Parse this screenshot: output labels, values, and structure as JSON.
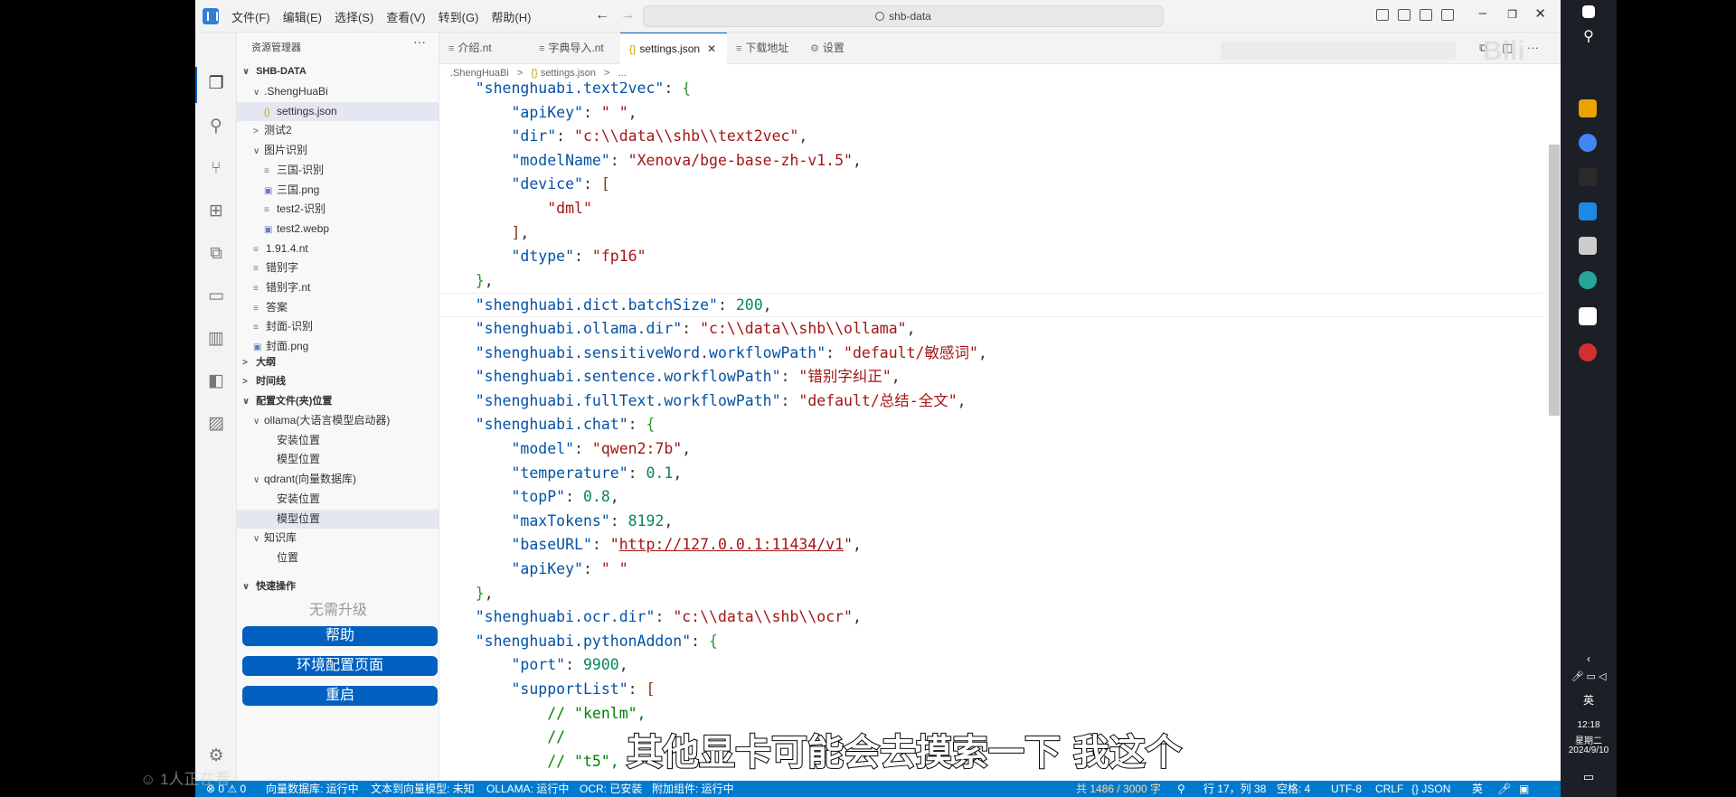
{
  "window": {
    "search": "shb-data",
    "menu": [
      "文件(F)",
      "编辑(E)",
      "选择(S)",
      "查看(V)",
      "转到(G)",
      "帮助(H)"
    ]
  },
  "sidebar": {
    "title": "资源管理器",
    "root": "SHB-DATA",
    "tree": [
      {
        "label": ".ShengHuaBi",
        "indent": 1,
        "chev": "∨"
      },
      {
        "label": "settings.json",
        "indent": 2,
        "icon": "{}",
        "selected": true
      },
      {
        "label": "测试2",
        "indent": 1,
        "chev": ">"
      },
      {
        "label": "图片识别",
        "indent": 1,
        "chev": "∨"
      },
      {
        "label": "三国-识别",
        "indent": 2,
        "icon": "≡"
      },
      {
        "label": "三国.png",
        "indent": 2,
        "icon": "▣"
      },
      {
        "label": "test2-识别",
        "indent": 2,
        "icon": "≡"
      },
      {
        "label": "test2.webp",
        "indent": 2,
        "icon": "▣"
      },
      {
        "label": "1.91.4.nt",
        "indent": 1,
        "icon": "≡"
      },
      {
        "label": "错别字",
        "indent": 1,
        "icon": "≡"
      },
      {
        "label": "错别字.nt",
        "indent": 1,
        "icon": "≡"
      },
      {
        "label": "答案",
        "indent": 1,
        "icon": "≡"
      },
      {
        "label": "封面-识别",
        "indent": 1,
        "icon": "≡"
      },
      {
        "label": "封面.png",
        "indent": 1,
        "icon": "▣"
      }
    ],
    "sections": [
      "大纲",
      "时间线",
      "配置文件(夹)位置"
    ],
    "config_tree": [
      {
        "label": "ollama(大语言模型启动器)",
        "indent": 1,
        "chev": "∨"
      },
      {
        "label": "安装位置",
        "indent": 2
      },
      {
        "label": "模型位置",
        "indent": 2
      },
      {
        "label": "qdrant(向量数据库)",
        "indent": 1,
        "chev": "∨"
      },
      {
        "label": "安装位置",
        "indent": 2
      },
      {
        "label": "模型位置",
        "indent": 2,
        "selected": true
      },
      {
        "label": "知识库",
        "indent": 1,
        "chev": "∨"
      },
      {
        "label": "位置",
        "indent": 2
      }
    ],
    "quick_ops_title": "快速操作",
    "no_upgrade": "无需升级",
    "buttons": [
      "帮助",
      "环境配置页面",
      "重启"
    ]
  },
  "tabs": [
    {
      "label": "介绍.nt",
      "icon": "≡"
    },
    {
      "label": "字典导入.nt",
      "icon": "≡"
    },
    {
      "label": "settings.json",
      "icon": "{}",
      "active": true
    },
    {
      "label": "下载地址",
      "icon": "≡"
    },
    {
      "label": "设置",
      "icon": "⚙"
    }
  ],
  "breadcrumb": [
    ".ShengHuaBi",
    "settings.json",
    "..."
  ],
  "code": [
    [
      [
        "p",
        "    "
      ],
      [
        "k",
        "\"shenghuabi.text2vec\""
      ],
      [
        "p",
        ": "
      ],
      [
        "b1",
        "{"
      ]
    ],
    [
      [
        "p",
        "        "
      ],
      [
        "k",
        "\"apiKey\""
      ],
      [
        "p",
        ": "
      ],
      [
        "s",
        "\" \""
      ],
      [
        "p",
        ","
      ]
    ],
    [
      [
        "p",
        "        "
      ],
      [
        "k",
        "\"dir\""
      ],
      [
        "p",
        ": "
      ],
      [
        "s",
        "\"c:\\\\data\\\\shb\\\\text2vec\""
      ],
      [
        "p",
        ","
      ]
    ],
    [
      [
        "p",
        "        "
      ],
      [
        "k",
        "\"modelName\""
      ],
      [
        "p",
        ": "
      ],
      [
        "s",
        "\"Xenova/bge-base-zh-v1.5\""
      ],
      [
        "p",
        ","
      ]
    ],
    [
      [
        "p",
        "        "
      ],
      [
        "k",
        "\"device\""
      ],
      [
        "p",
        ": "
      ],
      [
        "b2",
        "["
      ]
    ],
    [
      [
        "p",
        "            "
      ],
      [
        "s",
        "\"dml\""
      ]
    ],
    [
      [
        "p",
        "        "
      ],
      [
        "b2",
        "]"
      ],
      [
        "p",
        ","
      ]
    ],
    [
      [
        "p",
        "        "
      ],
      [
        "k",
        "\"dtype\""
      ],
      [
        "p",
        ": "
      ],
      [
        "s",
        "\"fp16\""
      ]
    ],
    [
      [
        "p",
        "    "
      ],
      [
        "b1",
        "}"
      ],
      [
        "p",
        ","
      ]
    ],
    [
      [
        "p",
        "    "
      ],
      [
        "k",
        "\"shenghuabi.dict.batchSize\""
      ],
      [
        "p",
        ": "
      ],
      [
        "n",
        "200"
      ],
      [
        "p",
        ","
      ]
    ],
    [
      [
        "p",
        "    "
      ],
      [
        "k",
        "\"shenghuabi.ollama.dir\""
      ],
      [
        "p",
        ": "
      ],
      [
        "s",
        "\"c:\\\\data\\\\shb\\\\ollama\""
      ],
      [
        "p",
        ","
      ]
    ],
    [
      [
        "p",
        "    "
      ],
      [
        "k",
        "\"shenghuabi.sensitiveWord.workflowPath\""
      ],
      [
        "p",
        ": "
      ],
      [
        "s",
        "\"default/敏感词\""
      ],
      [
        "p",
        ","
      ]
    ],
    [
      [
        "p",
        "    "
      ],
      [
        "k",
        "\"shenghuabi.sentence.workflowPath\""
      ],
      [
        "p",
        ": "
      ],
      [
        "s",
        "\"错别字纠正\""
      ],
      [
        "p",
        ","
      ]
    ],
    [
      [
        "p",
        "    "
      ],
      [
        "k",
        "\"shenghuabi.fullText.workflowPath\""
      ],
      [
        "p",
        ": "
      ],
      [
        "s",
        "\"default/总结-全文\""
      ],
      [
        "p",
        ","
      ]
    ],
    [
      [
        "p",
        "    "
      ],
      [
        "k",
        "\"shenghuabi.chat\""
      ],
      [
        "p",
        ": "
      ],
      [
        "b1",
        "{"
      ]
    ],
    [
      [
        "p",
        "        "
      ],
      [
        "k",
        "\"model\""
      ],
      [
        "p",
        ": "
      ],
      [
        "s",
        "\"qwen2:7b\""
      ],
      [
        "p",
        ","
      ]
    ],
    [
      [
        "p",
        "        "
      ],
      [
        "k",
        "\"temperature\""
      ],
      [
        "p",
        ": "
      ],
      [
        "n",
        "0.1"
      ],
      [
        "p",
        ","
      ]
    ],
    [
      [
        "p",
        "        "
      ],
      [
        "k",
        "\"topP\""
      ],
      [
        "p",
        ": "
      ],
      [
        "n",
        "0.8"
      ],
      [
        "p",
        ","
      ]
    ],
    [
      [
        "p",
        "        "
      ],
      [
        "k",
        "\"maxTokens\""
      ],
      [
        "p",
        ": "
      ],
      [
        "n",
        "8192"
      ],
      [
        "p",
        ","
      ]
    ],
    [
      [
        "p",
        "        "
      ],
      [
        "k",
        "\"baseURL\""
      ],
      [
        "p",
        ": "
      ],
      [
        "s",
        "\""
      ],
      [
        "url",
        "http://127.0.0.1:11434/v1"
      ],
      [
        "s",
        "\""
      ],
      [
        "p",
        ","
      ]
    ],
    [
      [
        "p",
        "        "
      ],
      [
        "k",
        "\"apiKey\""
      ],
      [
        "p",
        ": "
      ],
      [
        "s",
        "\" \""
      ]
    ],
    [
      [
        "p",
        "    "
      ],
      [
        "b1",
        "}"
      ],
      [
        "p",
        ","
      ]
    ],
    [
      [
        "p",
        "    "
      ],
      [
        "k",
        "\"shenghuabi.ocr.dir\""
      ],
      [
        "p",
        ": "
      ],
      [
        "s",
        "\"c:\\\\data\\\\shb\\\\ocr\""
      ],
      [
        "p",
        ","
      ]
    ],
    [
      [
        "p",
        "    "
      ],
      [
        "k",
        "\"shenghuabi.pythonAddon\""
      ],
      [
        "p",
        ": "
      ],
      [
        "b1",
        "{"
      ]
    ],
    [
      [
        "p",
        "        "
      ],
      [
        "k",
        "\"port\""
      ],
      [
        "p",
        ": "
      ],
      [
        "n",
        "9900"
      ],
      [
        "p",
        ","
      ]
    ],
    [
      [
        "p",
        "        "
      ],
      [
        "k",
        "\"supportList\""
      ],
      [
        "p",
        ": "
      ],
      [
        "b2",
        "["
      ]
    ],
    [
      [
        "p",
        "            "
      ],
      [
        "c",
        "// \"kenlm\","
      ]
    ],
    [
      [
        "p",
        "            "
      ],
      [
        "c",
        "// "
      ]
    ],
    [
      [
        "p",
        "            "
      ],
      [
        "c",
        "// \"t5\","
      ]
    ]
  ],
  "statusbar": {
    "problems": "⊗ 0 ⚠ 0",
    "items": [
      "向量数据库: 运行中",
      "文本到向量模型: 未知",
      "OLLAMA: 运行中",
      "OCR: 已安装",
      "附加组件: 运行中"
    ],
    "char_count": "共 1486 / 3000 字",
    "position": "行 17，列 38",
    "spaces": "空格: 4",
    "encoding": "UTF-8",
    "eol": "CRLF",
    "lang": "{} JSON"
  },
  "taskbar": {
    "time": "12:18",
    "weekday": "星期二",
    "date": "2024/9/10",
    "ime": "英",
    "colors": [
      "#e8a300",
      "#4285f4",
      "#2b2b2b",
      "#1e88e5",
      "#cccccc",
      "#26a69a",
      "#ffffff",
      "#d32f2f"
    ]
  },
  "subtitle": "其他显卡可能会去摸索一下 我这个",
  "viewers": "1人正在看"
}
